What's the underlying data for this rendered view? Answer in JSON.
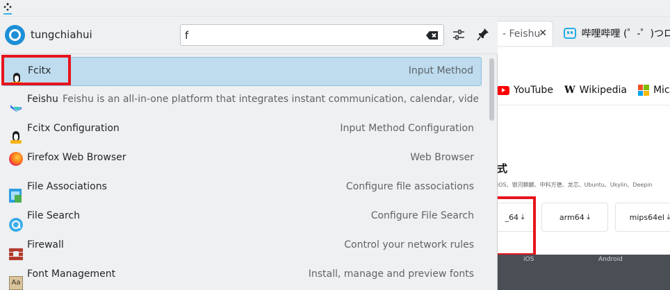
{
  "topbar": {
    "app_icon": "loading-dots-icon"
  },
  "launcher": {
    "username": "tungchiahui",
    "search": {
      "value": "f",
      "placeholder": ""
    },
    "results": [
      {
        "name": "Fcitx",
        "description": "Input Method",
        "icon": "penguin-icon",
        "selected": true
      },
      {
        "name": "Feishu",
        "description": "Feishu is an all-in-one platform that integrates instant communication, calendar, video m...",
        "icon": "feishu-icon",
        "selected": false
      },
      {
        "name": "Fcitx Configuration",
        "description": "Input Method Configuration",
        "icon": "penguin-icon",
        "selected": false
      },
      {
        "name": "Firefox Web Browser",
        "description": "Web Browser",
        "icon": "firefox-icon",
        "selected": false
      },
      {
        "name": "File Associations",
        "description": "Configure file associations",
        "icon": "file-associations-icon",
        "selected": false
      },
      {
        "name": "File Search",
        "description": "Configure File Search",
        "icon": "file-search-icon",
        "selected": false
      },
      {
        "name": "Firewall",
        "description": "Control your network rules",
        "icon": "firewall-icon",
        "selected": false
      },
      {
        "name": "Font Management",
        "description": "Install, manage and preview fonts",
        "icon": "font-management-icon",
        "selected": false
      }
    ]
  },
  "browser": {
    "tabs": [
      {
        "label": "- Feishu",
        "close": "✕"
      },
      {
        "label": "哔哩哔哩 (゜-゜)つロ"
      }
    ],
    "bookmarks": [
      {
        "label": "YouTube",
        "icon": "youtube-icon"
      },
      {
        "label": "Wikipedia",
        "icon": "wikipedia-icon"
      },
      {
        "label": "Mic",
        "icon": "microsoft-icon"
      }
    ],
    "heading": "式",
    "subtext": "iOS、银河麒麟、中科方德、龙芯、Ubuntu、Ukylin、Deepin",
    "downloads": [
      {
        "label": "_64",
        "arrow": "⤓"
      },
      {
        "label": "arm64",
        "arrow": "⤓"
      },
      {
        "label": "mips64el",
        "arrow": "⤓"
      }
    ],
    "platforms": [
      "iOS",
      "Android"
    ]
  },
  "colors": {
    "selection_bg": "#bedcee",
    "highlight_red": "#e8141c",
    "avatar_blue": "#1d8fd6"
  }
}
